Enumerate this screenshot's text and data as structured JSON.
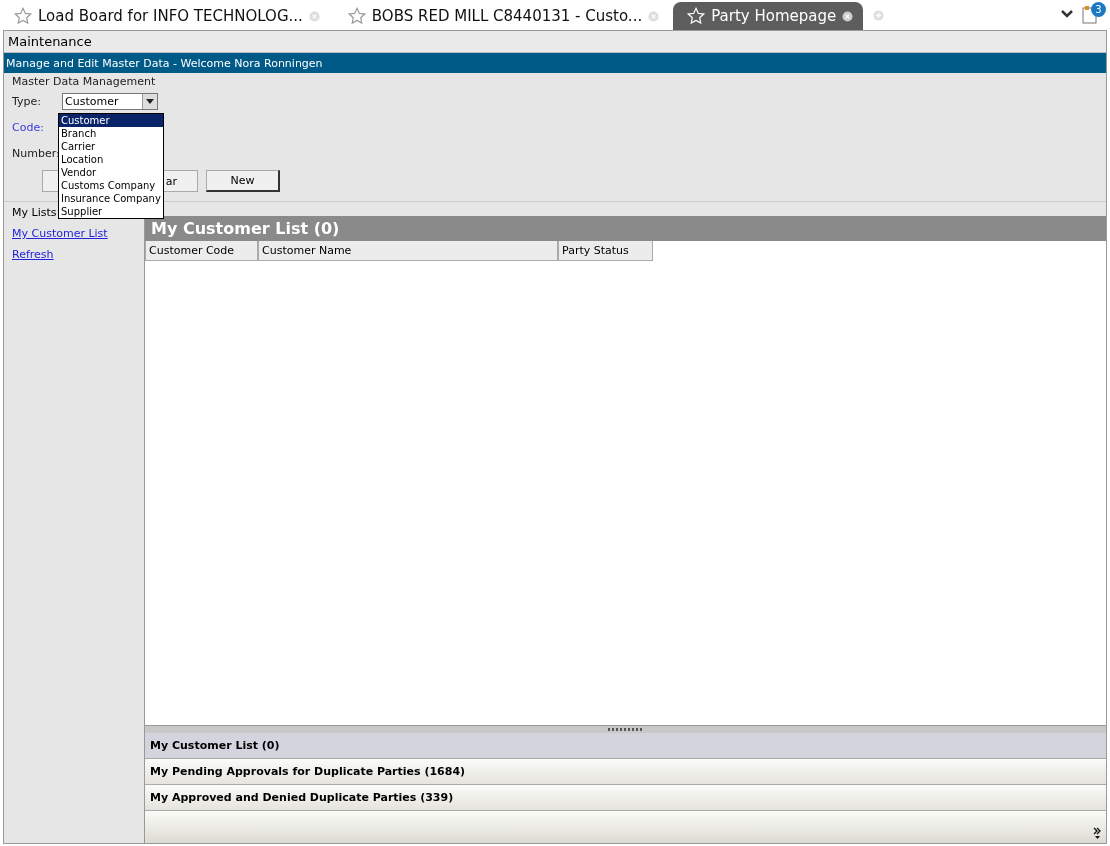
{
  "tabs": [
    {
      "label": "Load Board for INFO TECHNOLOG...",
      "selected": false
    },
    {
      "label": "BOBS RED MILL C8440131 - Custo...",
      "selected": false
    },
    {
      "label": "Party Homepage",
      "selected": true
    }
  ],
  "notification_count": "3",
  "toolbar": {
    "title": "Maintenance"
  },
  "header": {
    "title": "Manage and Edit Master Data - Welcome Nora Ronningen"
  },
  "form": {
    "section_title": "Master Data Management",
    "type_label": "Type:",
    "type_value": "Customer",
    "code_label": "Code:",
    "number_label": "Number:",
    "dropdown_options": [
      {
        "label": "Customer",
        "selected": true
      },
      {
        "label": "Branch",
        "selected": false
      },
      {
        "label": "Carrier",
        "selected": false
      },
      {
        "label": "Location",
        "selected": false
      },
      {
        "label": "Vendor",
        "selected": false
      },
      {
        "label": "Customs Company",
        "selected": false
      },
      {
        "label": "Insurance Company",
        "selected": false
      },
      {
        "label": "Supplier",
        "selected": false
      }
    ],
    "buttons": [
      {
        "kind": "blank"
      },
      {
        "kind": "plain",
        "label": "ar"
      },
      {
        "kind": "default",
        "label": "New"
      }
    ]
  },
  "sidebar": {
    "title": "My Lists",
    "links": [
      "My Customer List",
      "Refresh"
    ]
  },
  "list_panel": {
    "title": "My Customer List (0)",
    "columns": [
      "Customer Code",
      "Customer Name",
      "Party Status"
    ]
  },
  "accordion": [
    {
      "label": "My Customer List (0)",
      "selected": true
    },
    {
      "label": "My Pending Approvals for Duplicate Parties (1684)",
      "selected": false
    },
    {
      "label": "My Approved and Denied Duplicate Parties (339)",
      "selected": false
    }
  ]
}
